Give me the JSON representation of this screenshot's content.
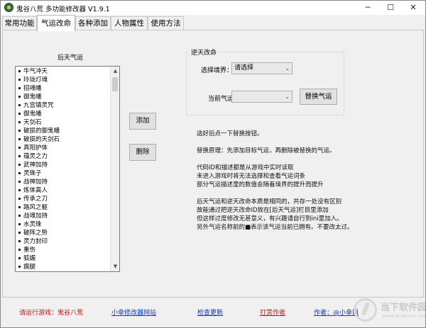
{
  "window": {
    "title": "鬼谷八荒 多功能修改器  V1.9.1",
    "minimize": "─",
    "maximize": "☐",
    "close": "✕"
  },
  "tabs": [
    {
      "label": "常用功能",
      "active": false
    },
    {
      "label": "气运改命",
      "active": true
    },
    {
      "label": "各种添加",
      "active": false
    },
    {
      "label": "人物属性",
      "active": false
    },
    {
      "label": "使用方法",
      "active": false
    }
  ],
  "left_panel": {
    "caption": "后天气运",
    "items": [
      "牛气冲天",
      "玲珑灯魂",
      "招魂幡",
      "御鬼幡",
      "九宫镇灵咒",
      "御鬼幡",
      "天剑石",
      "破损的御鬼幡",
      "破损的天剑石",
      "真阳护体",
      "蕴灵之力",
      "武神加持",
      "灵珠子",
      "战神加持",
      "炼体高人",
      "传承之刀",
      "踏风之躯",
      "战魂加持",
      "水灵珠",
      "破阵之势",
      "灵力封印",
      "重伤",
      "狐媚",
      "瘸腿"
    ],
    "scroll_up": "▲",
    "scroll_down": "▼"
  },
  "buttons": {
    "add": "添加",
    "delete": "删除",
    "replace": "替换气运"
  },
  "group": {
    "title": "逆天改命",
    "realm_label": "选择境界：",
    "realm_value": "请选择",
    "current_luck_label": "当前气运",
    "current_luck_value": "",
    "chevron": "⌄"
  },
  "info_lines": [
    "选好后点一下替换按钮。",
    "替换原理：先添加目标气运，再删除被替换的气运。",
    "代码ID和描述都是从游戏中实时读取",
    "未进入游戏时将无法选择和查看气运词条",
    "部分气运描述里的数值会随着境界的提升而提升",
    "后天气运和逆天改命本质是相同的，共存一处没有区别",
    "故能通过把逆天改命ID放在[后天气运]栏目里添加",
    "但这样过度修改无甚意义，有兴趣请自行到ini里加入。",
    "另外气运名称前的■表示该气运当前已拥有。不要改太过。"
  ],
  "footer": {
    "run_game": "请运行游戏：鬼谷八荒",
    "website": "小幸修改器网站",
    "check_update": "检查更新",
    "donate": "打赏作者",
    "author": "作者：@小幸姐"
  },
  "watermark": {
    "main": "当下软件园",
    "sub": "www.downxia.com"
  },
  "colors": {
    "run_game": "#d01010",
    "website": "#0a39c8",
    "check_update": "#0a39c8",
    "donate": "#d01010",
    "author": "#0a39c8"
  }
}
